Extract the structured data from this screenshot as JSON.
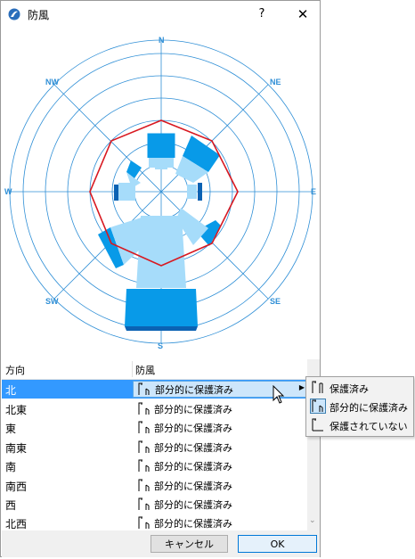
{
  "window": {
    "title": "防風",
    "help_label": "?",
    "close_label": "✕"
  },
  "compass": {
    "n": "N",
    "ne": "NE",
    "e": "E",
    "se": "SE",
    "s": "S",
    "sw": "SW",
    "w": "W",
    "nw": "NW"
  },
  "table": {
    "headers": {
      "direction": "方向",
      "protection": "防風"
    },
    "rows": [
      {
        "direction": "北",
        "protection": "部分的に保護済み"
      },
      {
        "direction": "北東",
        "protection": "部分的に保護済み"
      },
      {
        "direction": "東",
        "protection": "部分的に保護済み"
      },
      {
        "direction": "南東",
        "protection": "部分的に保護済み"
      },
      {
        "direction": "南",
        "protection": "部分的に保護済み"
      },
      {
        "direction": "南西",
        "protection": "部分的に保護済み"
      },
      {
        "direction": "西",
        "protection": "部分的に保護済み"
      },
      {
        "direction": "北西",
        "protection": "部分的に保護済み"
      }
    ],
    "selected_row": 0
  },
  "buttons": {
    "cancel": "キャンセル",
    "ok": "OK"
  },
  "menu": {
    "items": [
      {
        "label": "保護済み",
        "icon": "protected-icon"
      },
      {
        "label": "部分的に保護済み",
        "icon": "partially-protected-icon",
        "checked": true
      },
      {
        "label": "保護されていない",
        "icon": "unprotected-icon"
      }
    ]
  },
  "colors": {
    "grid": "#2f8fd6",
    "outline": "#d81820",
    "light_wedge": "#a6dcfa",
    "dark_wedge": "#089ae8",
    "selection": "#3399ff"
  }
}
